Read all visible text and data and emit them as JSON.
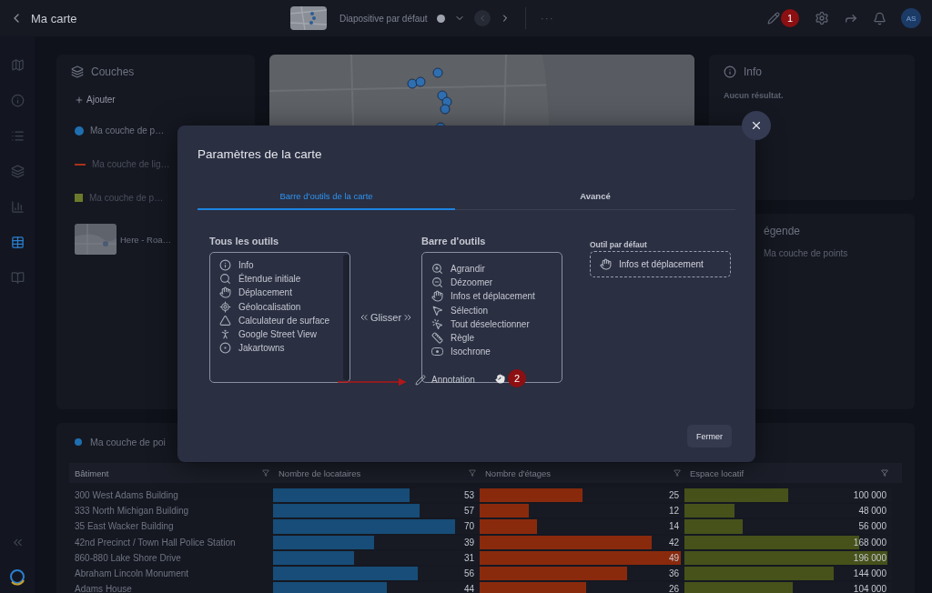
{
  "header": {
    "title": "Ma carte",
    "slide": "Diapositive par défaut",
    "more": "···",
    "step_badge": "1",
    "avatar": "AS"
  },
  "rail": [
    {
      "selected": false
    },
    {
      "selected": false
    },
    {
      "selected": false
    },
    {
      "selected": false
    },
    {
      "selected": false
    },
    {
      "selected": true
    },
    {
      "selected": false
    }
  ],
  "layers_panel": {
    "title": "Couches",
    "add": "Ajouter",
    "items": [
      {
        "kind": "point",
        "label": "Ma couche de p…",
        "color": "#1f6fb0",
        "visible": true
      },
      {
        "kind": "line",
        "label": "Ma couche de lig…",
        "color": "#a8321a",
        "visible": false
      },
      {
        "kind": "polygon",
        "label": "Ma couche de p…",
        "color": "#6b7a2a",
        "visible": false
      },
      {
        "kind": "basemap",
        "label": "Here - Roa…",
        "visible": true
      }
    ]
  },
  "info_panel": {
    "title": "Info",
    "message": "Aucun résultat."
  },
  "legend_panel": {
    "title": "égende",
    "items": [
      "Ma couche de points"
    ]
  },
  "table": {
    "title": "Ma couche de poi",
    "columns": [
      "Bâtiment",
      "Nombre de locataires",
      "Nombre d'étages",
      "Espace locatif"
    ],
    "rows": [
      {
        "cells": [
          {
            "text": "300 West Adams Building"
          },
          {
            "text": "53",
            "level": 0.66
          },
          {
            "text": "25",
            "level": 0.5
          },
          {
            "text": "100 000",
            "level": 0.5
          }
        ]
      },
      {
        "cells": [
          {
            "text": "333 North Michigan Building"
          },
          {
            "text": "57",
            "level": 0.71
          },
          {
            "text": "12",
            "level": 0.24
          },
          {
            "text": "48 000",
            "level": 0.24
          }
        ]
      },
      {
        "cells": [
          {
            "text": "35 East Wacker Building"
          },
          {
            "text": "70",
            "level": 0.88
          },
          {
            "text": "14",
            "level": 0.28
          },
          {
            "text": "56 000",
            "level": 0.28
          }
        ]
      },
      {
        "cells": [
          {
            "text": "42nd Precinct / Town Hall Police Station"
          },
          {
            "text": "39",
            "level": 0.49
          },
          {
            "text": "42",
            "level": 0.84
          },
          {
            "text": "168 000",
            "level": 0.84
          }
        ]
      },
      {
        "cells": [
          {
            "text": "860-880 Lake Shore Drive"
          },
          {
            "text": "31",
            "level": 0.39
          },
          {
            "text": "49",
            "level": 0.98
          },
          {
            "text": "196 000",
            "level": 0.98
          }
        ]
      },
      {
        "cells": [
          {
            "text": "Abraham Lincoln Monument"
          },
          {
            "text": "56",
            "level": 0.7
          },
          {
            "text": "36",
            "level": 0.72
          },
          {
            "text": "144 000",
            "level": 0.72
          }
        ]
      },
      {
        "cells": [
          {
            "text": "Adams House"
          },
          {
            "text": "44",
            "level": 0.55
          },
          {
            "text": "26",
            "level": 0.52
          },
          {
            "text": "104 000",
            "level": 0.52
          }
        ]
      }
    ]
  },
  "modal": {
    "title": "Paramètres de la carte",
    "tabs": [
      {
        "label": "Barre d'outils de la carte",
        "selected": true
      },
      {
        "label": "Avancé",
        "selected": false
      }
    ],
    "all_tools": {
      "title": "Tous les outils",
      "items": [
        "Info",
        "Étendue initiale",
        "Déplacement",
        "Géolocalisation",
        "Calculateur de surface",
        "Google Street View",
        "Jakartowns"
      ]
    },
    "drag_hint": "Glisser",
    "toolbar": {
      "title": "Barre d'outils",
      "items": [
        "Agrandir",
        "Dézoomer",
        "Infos et déplacement",
        "Sélection",
        "Tout déselectionner",
        "Règle",
        "Isochrone"
      ]
    },
    "dragged_item": "Annotation",
    "step_badge": "2",
    "default_tool": {
      "label": "Outil par défaut",
      "value": "Infos et déplacement"
    },
    "close_button": "Fermer"
  }
}
